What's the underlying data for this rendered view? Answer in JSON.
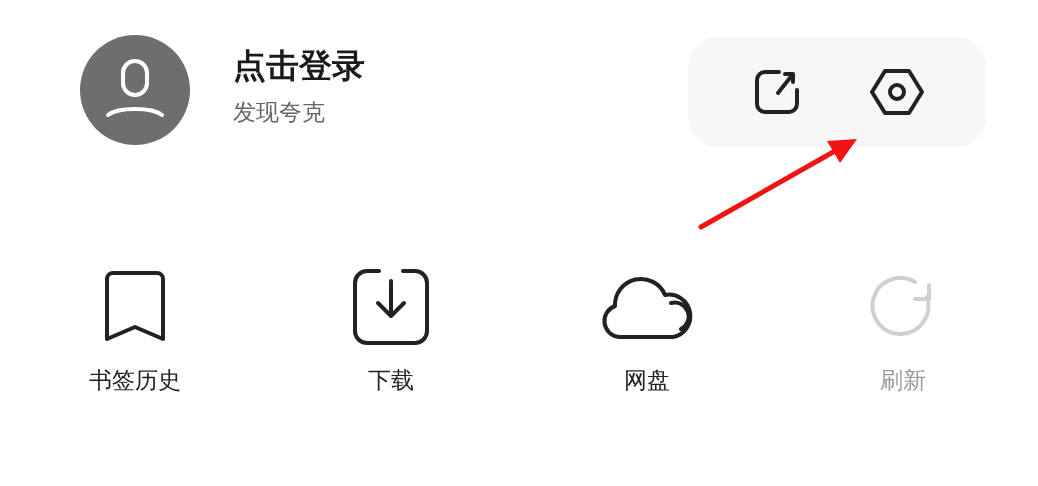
{
  "profile": {
    "title": "点击登录",
    "subtitle": "发现夸克"
  },
  "quick_actions": [
    {
      "kind": "edit"
    },
    {
      "kind": "settings"
    }
  ],
  "items": [
    {
      "label": "书签历史",
      "kind": "bookmark",
      "disabled": false
    },
    {
      "label": "下载",
      "kind": "download",
      "disabled": false
    },
    {
      "label": "网盘",
      "kind": "cloud",
      "disabled": false
    },
    {
      "label": "刷新",
      "kind": "refresh",
      "disabled": true
    }
  ],
  "annotation": {
    "kind": "arrow"
  }
}
